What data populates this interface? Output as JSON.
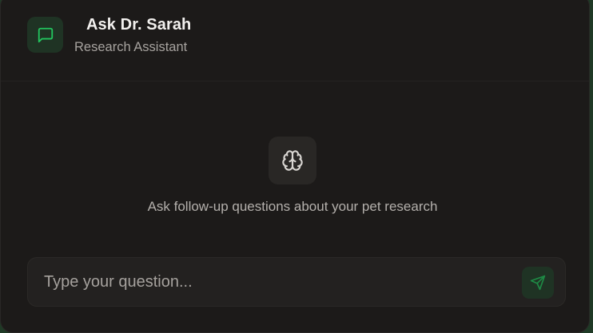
{
  "header": {
    "title": "Ask Dr. Sarah",
    "subtitle": "Research Assistant",
    "icon": "message-square-icon"
  },
  "empty_state": {
    "icon": "brain-icon",
    "hint": "Ask follow-up questions about your pet research"
  },
  "composer": {
    "value": "",
    "placeholder": "Type your question...",
    "send_icon": "send-icon"
  },
  "colors": {
    "accent": "#22c55e",
    "accent_bg": "#1f3324",
    "panel_bg": "#1c1a19",
    "page_bg": "#1f3a26"
  }
}
